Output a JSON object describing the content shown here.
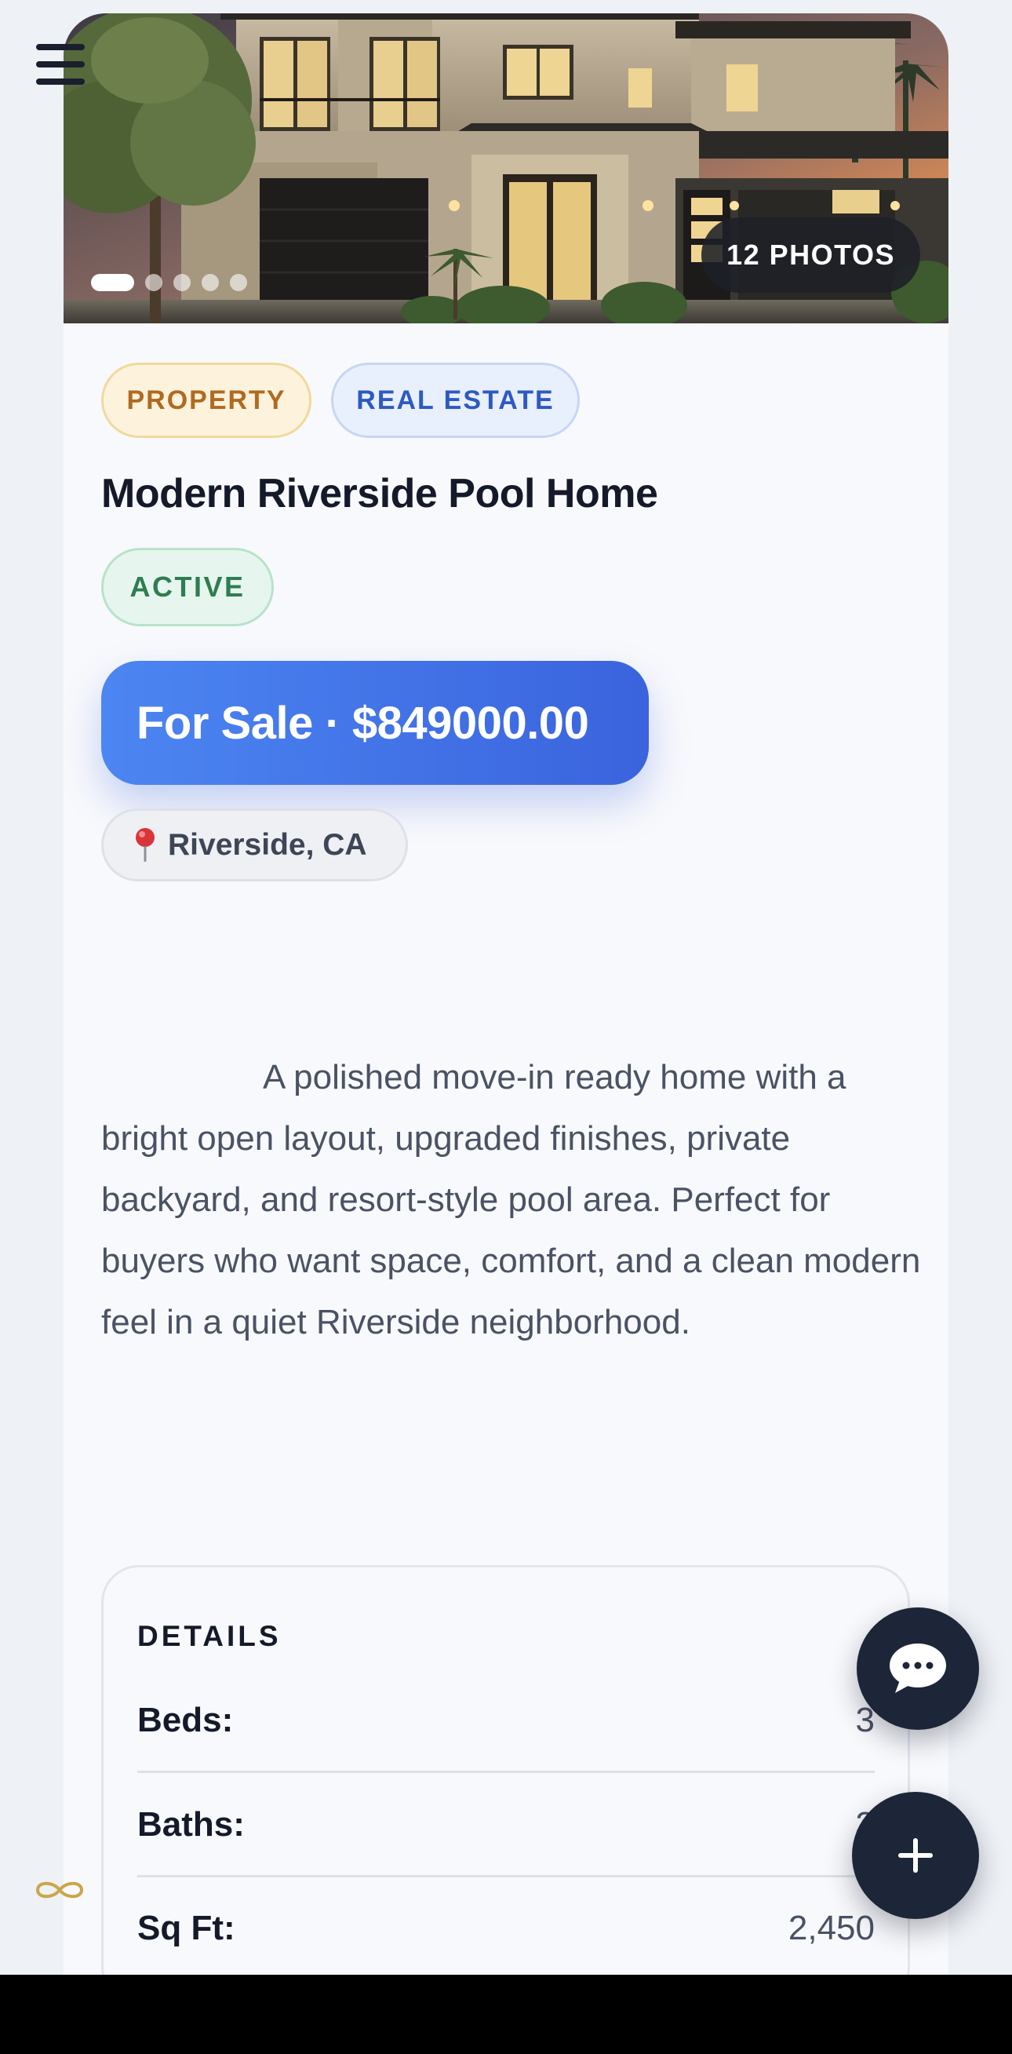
{
  "hero": {
    "photos_badge": "12 PHOTOS",
    "carousel_dot_count": 5,
    "active_dot_index": 0
  },
  "listing": {
    "tags": [
      "PROPERTY",
      "REAL ESTATE"
    ],
    "title": "Modern Riverside Pool Home",
    "status": "ACTIVE",
    "price_line": "For Sale · $849000.00",
    "location": "Riverside, CA",
    "description": "A polished move-in ready home with a bright open layout, upgraded finishes, private backyard, and resort-style pool area. Perfect for buyers who want space, comfort, and a clean modern feel in a quiet Riverside neighborhood."
  },
  "details": {
    "title": "DETAILS",
    "rows": [
      {
        "label": "Beds:",
        "value": "3"
      },
      {
        "label": "Baths:",
        "value": "3"
      },
      {
        "label": "Sq Ft:",
        "value": "2,450"
      }
    ]
  },
  "icons": {
    "menu": "hamburger-menu-icon",
    "location": "map-pin-icon",
    "chat": "chat-bubble-icon",
    "add": "plus-icon",
    "brand": "infinity-icon"
  },
  "colors": {
    "primary": "#3a63dd",
    "dark": "#1d2638",
    "status_green": "#2f7d52",
    "property_tag": "#b06a20",
    "realestate_tag": "#2e59c3"
  }
}
